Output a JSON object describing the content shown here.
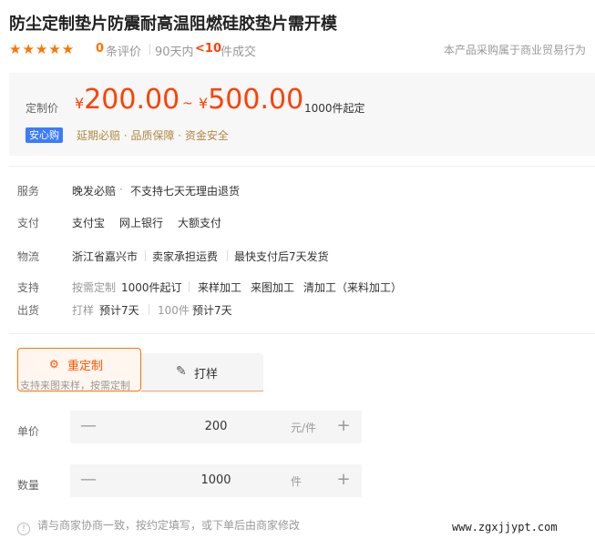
{
  "product": {
    "title": "防尘定制垫片防震耐高温阻燃硅胶垫片需开模"
  },
  "rating": {
    "stars": "★★★★★",
    "review_count": "0",
    "review_label": "条评价",
    "period": "90天内",
    "deals": "<10",
    "deals_label": "件成交",
    "note": "本产品采购属于商业贸易行为"
  },
  "price": {
    "label": "定制价",
    "currency": "¥",
    "min": "200.00",
    "tilde": "~",
    "max": "500.00",
    "moq": "1000件起定",
    "badge": "安心购",
    "guarantees": "延期必赔 · 品质保障 · 资金安全",
    "accent_color": "#ff4000"
  },
  "service": {
    "label": "服务",
    "items": [
      "晚发必赔",
      "·",
      "不支持七天无理由退货"
    ]
  },
  "payment": {
    "label": "支付",
    "items": [
      "支付宝",
      "网上银行",
      "大额支付"
    ]
  },
  "logistics": {
    "label": "物流",
    "items": [
      "浙江省嘉兴市",
      "卖家承担运费",
      "最快支付后7天发货"
    ]
  },
  "support": {
    "label": "支持",
    "items": [
      "按需定制",
      "1000件起订",
      "来样加工",
      "来图加工",
      "清加工（来料加工）"
    ]
  },
  "shipping": {
    "label": "出货",
    "items": [
      "打样",
      "预计7天",
      "100件",
      "预计7天"
    ]
  },
  "tabs": {
    "custom": {
      "icon": "sliders-icon",
      "label": "重定制",
      "sub": "支持来图来样，按需定制"
    },
    "proof": {
      "icon": "tools-icon",
      "label": "打样"
    }
  },
  "unit_price": {
    "label": "单价",
    "value": "200",
    "unit": "元/件",
    "minus": "—",
    "plus": "+"
  },
  "quantity": {
    "label": "数量",
    "value": "1000",
    "unit": "件",
    "minus": "—",
    "plus": "+"
  },
  "tip": {
    "icon": "info-icon",
    "text": "请与商家协商一致，按约定填写，或下单后由商家修改"
  },
  "watermark": "www.zgxjjypt.com"
}
